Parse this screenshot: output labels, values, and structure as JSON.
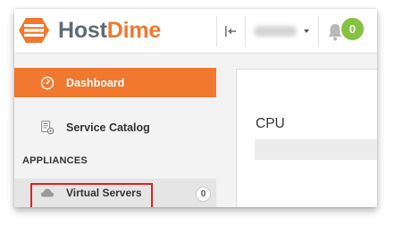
{
  "brand": {
    "name_part1": "Host",
    "name_part2": "Dime",
    "color_gray": "#5f6b73",
    "color_orange": "#f0782f"
  },
  "topbar": {
    "collapse_icon": "collapse-sidebar-icon",
    "user_name": "",
    "user_caret_icon": "caret-down-icon",
    "notifications_icon": "bell-icon",
    "notifications_count": "0",
    "notifications_badge_color": "#84c240"
  },
  "sidebar": {
    "items": [
      {
        "label": "Dashboard",
        "icon": "speedometer-icon",
        "active": true
      },
      {
        "label": "Service Catalog",
        "icon": "catalog-gear-icon",
        "active": false
      }
    ],
    "section_heading": "APPLIANCES",
    "appliances": [
      {
        "label": "Virtual Servers",
        "icon": "cloud-icon",
        "count": "0",
        "highlighted": true
      }
    ]
  },
  "main": {
    "panel_title": "CPU",
    "progress_fraction": 0
  },
  "colors": {
    "accent": "#f0782f",
    "highlight": "#e02020"
  }
}
